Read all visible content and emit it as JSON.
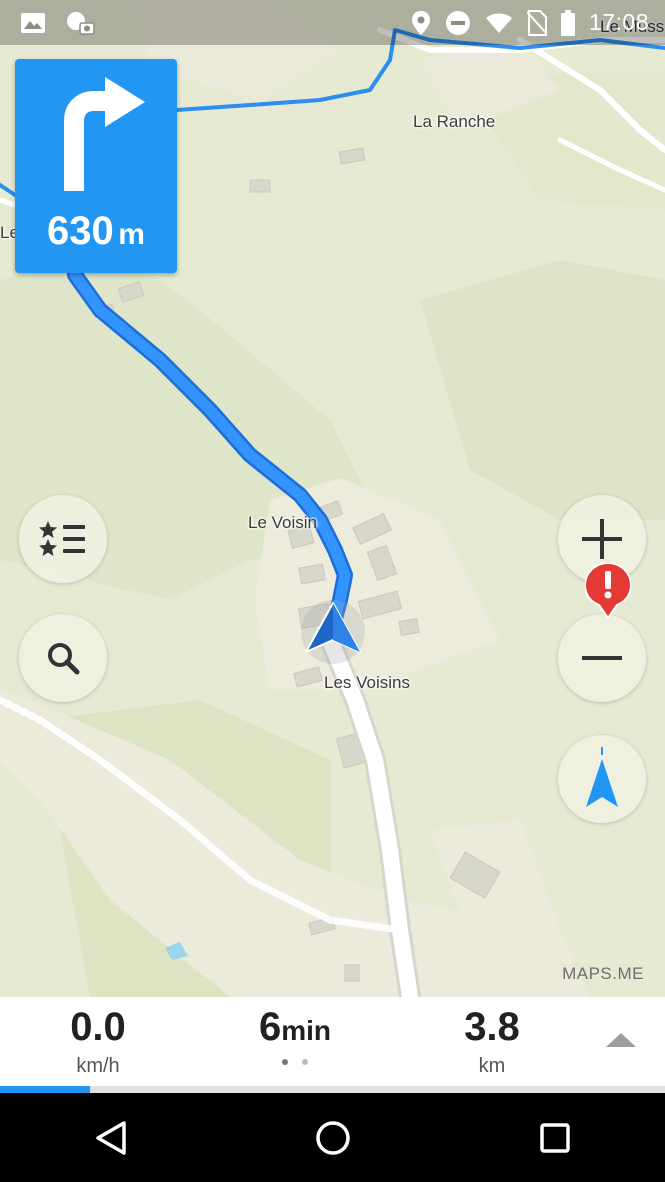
{
  "status_bar": {
    "time": "17:08",
    "icons": [
      "image-icon",
      "weather-icon",
      "location-pin-icon",
      "do-not-disturb-icon",
      "wifi-icon",
      "no-sim-icon",
      "battery-icon"
    ]
  },
  "turn": {
    "direction": "turn-right",
    "distance_value": "630",
    "distance_unit": "m"
  },
  "map": {
    "labels": {
      "la_ranche": "La Ranche",
      "le_voisin": "Le Voisin",
      "les_voisins": "Les Voisins",
      "partial_top_right": "Le Muss",
      "partial_left": "Le"
    },
    "attribution": "MAPS.ME",
    "colors": {
      "background": "#e6ead3",
      "route": "#2b8ef0",
      "accent": "#2196f3",
      "alert": "#e53935"
    }
  },
  "controls": {
    "bookmarks_icon": "star-list-icon",
    "search_icon": "search-icon",
    "zoom_in_icon": "plus-icon",
    "zoom_out_icon": "minus-icon",
    "my_position_icon": "navigation-arrow-icon",
    "alert_icon": "exclamation-icon"
  },
  "nav_panel": {
    "speed": {
      "value": "0.0",
      "unit": "km/h"
    },
    "time": {
      "value": "6",
      "unit": "min"
    },
    "distance": {
      "value": "3.8",
      "unit": "km"
    },
    "page_dots": 2,
    "active_dot": 0,
    "progress_fraction": 0.135,
    "expand_icon": "chevron-up-icon"
  },
  "system_nav": {
    "back_icon": "back-triangle-icon",
    "home_icon": "home-circle-icon",
    "recents_icon": "recents-square-icon"
  }
}
